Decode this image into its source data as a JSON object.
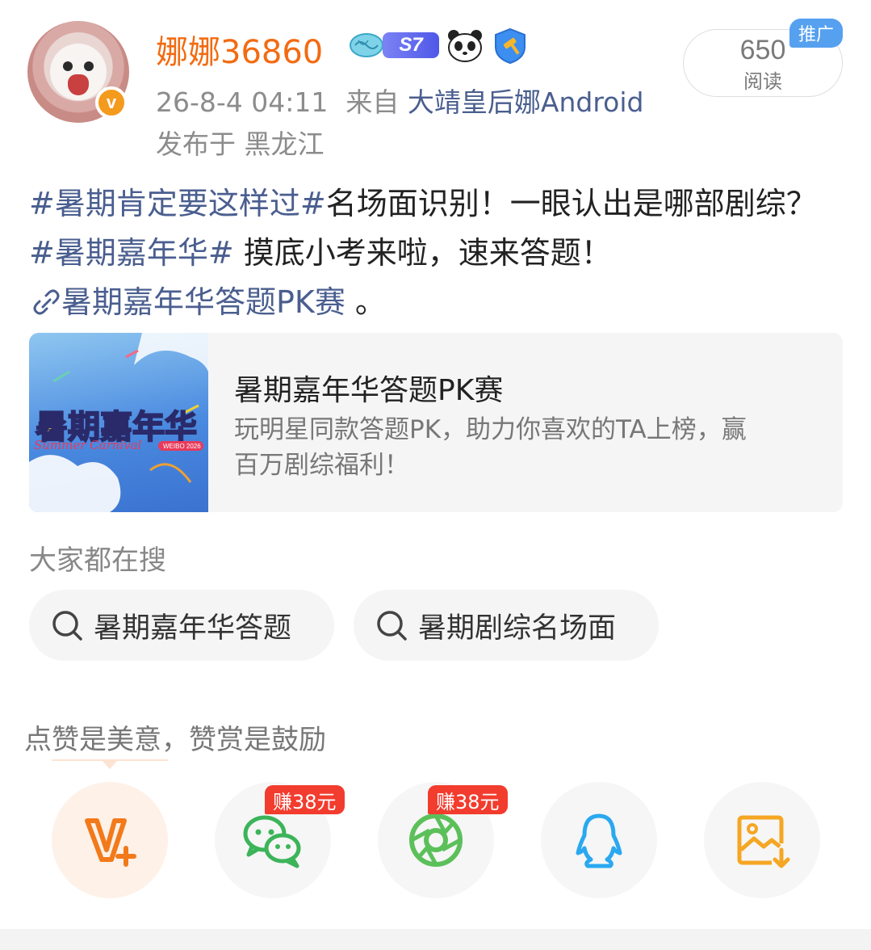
{
  "header": {
    "username": "娜娜36860",
    "level_badge": "S7",
    "timestamp": "26-8-4 04:11",
    "from_label": "来自",
    "source": "大靖皇后娜Android",
    "location": "发布于 黑龙江",
    "verified_mark": "v",
    "read_count": "650",
    "read_label": "阅读",
    "promo_tag": "推广"
  },
  "post": {
    "tag1": "#暑期肯定要这样过#",
    "text1": "名场面识别！一眼认出是哪部剧综？",
    "tag2": "#暑期嘉年华#",
    "text2": " 摸底小考来啦，速来答题！",
    "link_text": "暑期嘉年华答题PK赛",
    "text3": " 。"
  },
  "card": {
    "title": "暑期嘉年华答题PK赛",
    "description": "玩明星同款答题PK，助力你喜欢的TA上榜，赢百万剧综福利！",
    "image_title": "暑期嘉年华",
    "image_subtitle": "Summer Carnival",
    "image_brand": "WEIBO 2026"
  },
  "search": {
    "heading": "大家都在搜",
    "items": [
      "暑期嘉年华答题",
      "暑期剧综名场面"
    ]
  },
  "reward": {
    "text": "点赞是美意，赞赏是鼓励"
  },
  "share": {
    "earn_badges": [
      "赚38元",
      "赚38元"
    ],
    "icons": [
      "v-plus-icon",
      "wechat-icon",
      "moments-icon",
      "qq-icon",
      "save-image-icon"
    ]
  },
  "colors": {
    "username": "#f26b12",
    "link": "#4a5e8f",
    "earn_badge": "#f23c2e",
    "promo_tag": "#56a0f0"
  }
}
